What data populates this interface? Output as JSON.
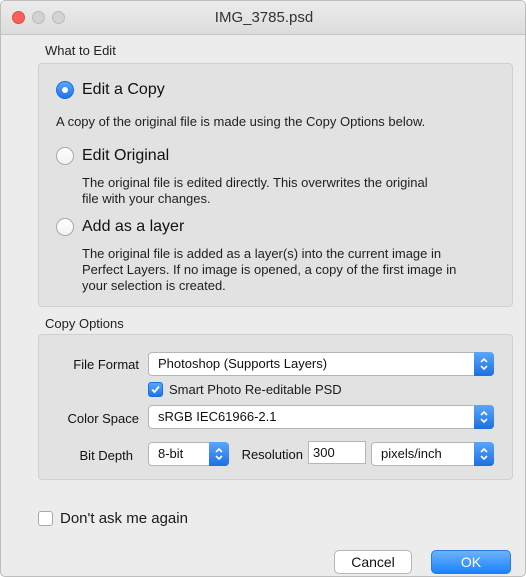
{
  "window": {
    "title": "IMG_3785.psd"
  },
  "what_to_edit": {
    "label": "What to Edit",
    "options": [
      {
        "label": "Edit a Copy",
        "selected": true,
        "description": "A copy of the original file is made using the Copy Options below."
      },
      {
        "label": "Edit Original",
        "selected": false,
        "description_lines": [
          "The original file is edited directly.  This overwrites the original",
          "file with your changes."
        ]
      },
      {
        "label": "Add as a layer",
        "selected": false,
        "description_lines": [
          "The original file is added as a layer(s) into the current image in",
          "Perfect Layers.  If no image is opened, a copy of the first image in",
          "your selection is created."
        ]
      }
    ]
  },
  "copy_options": {
    "label": "Copy Options",
    "file_format": {
      "label": "File Format",
      "value": "Photoshop (Supports Layers)"
    },
    "smart_photo": {
      "label": "Smart Photo Re-editable PSD",
      "checked": true
    },
    "color_space": {
      "label": "Color Space",
      "value": "sRGB IEC61966-2.1"
    },
    "bit_depth": {
      "label": "Bit Depth",
      "value": "8-bit"
    },
    "resolution": {
      "label": "Resolution",
      "value": "300",
      "unit": "pixels/inch"
    }
  },
  "dont_ask": {
    "label": "Don't ask me again",
    "checked": false
  },
  "buttons": {
    "cancel": "Cancel",
    "ok": "OK"
  },
  "colors": {
    "accent": "#1c74e9",
    "close": "#fc5f57"
  }
}
